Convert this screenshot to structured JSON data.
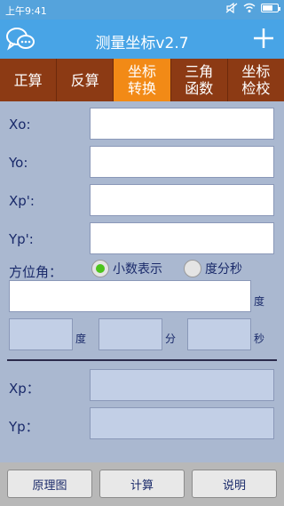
{
  "status": {
    "time": "上午9:41",
    "battery_level": 0.7
  },
  "header": {
    "title": "测量坐标v2.7",
    "menu_icon": "chat-bubbles-icon",
    "add_icon": "plus-icon"
  },
  "tabs": [
    {
      "label": "正算",
      "active": false
    },
    {
      "label": "反算",
      "active": false
    },
    {
      "label": "坐标\n转换",
      "active": true
    },
    {
      "label": "三角\n函数",
      "active": false
    },
    {
      "label": "坐标\n检校",
      "active": false
    }
  ],
  "form": {
    "xo_label": "Xo:",
    "yo_label": "Yo:",
    "xp_prime_label": "Xp':",
    "yp_prime_label": "Yp':",
    "azimuth_label": "方位角：",
    "decimal_option": "小数表示",
    "dms_option": "度分秒",
    "selected_format": "小数表示",
    "degree_unit": "度",
    "minute_unit": "分",
    "second_unit": "秒",
    "xp_label": "Xp：",
    "yp_label": "Yp："
  },
  "footer": {
    "diagram_button": "原理图",
    "calculate_button": "计算",
    "help_button": "说明"
  }
}
